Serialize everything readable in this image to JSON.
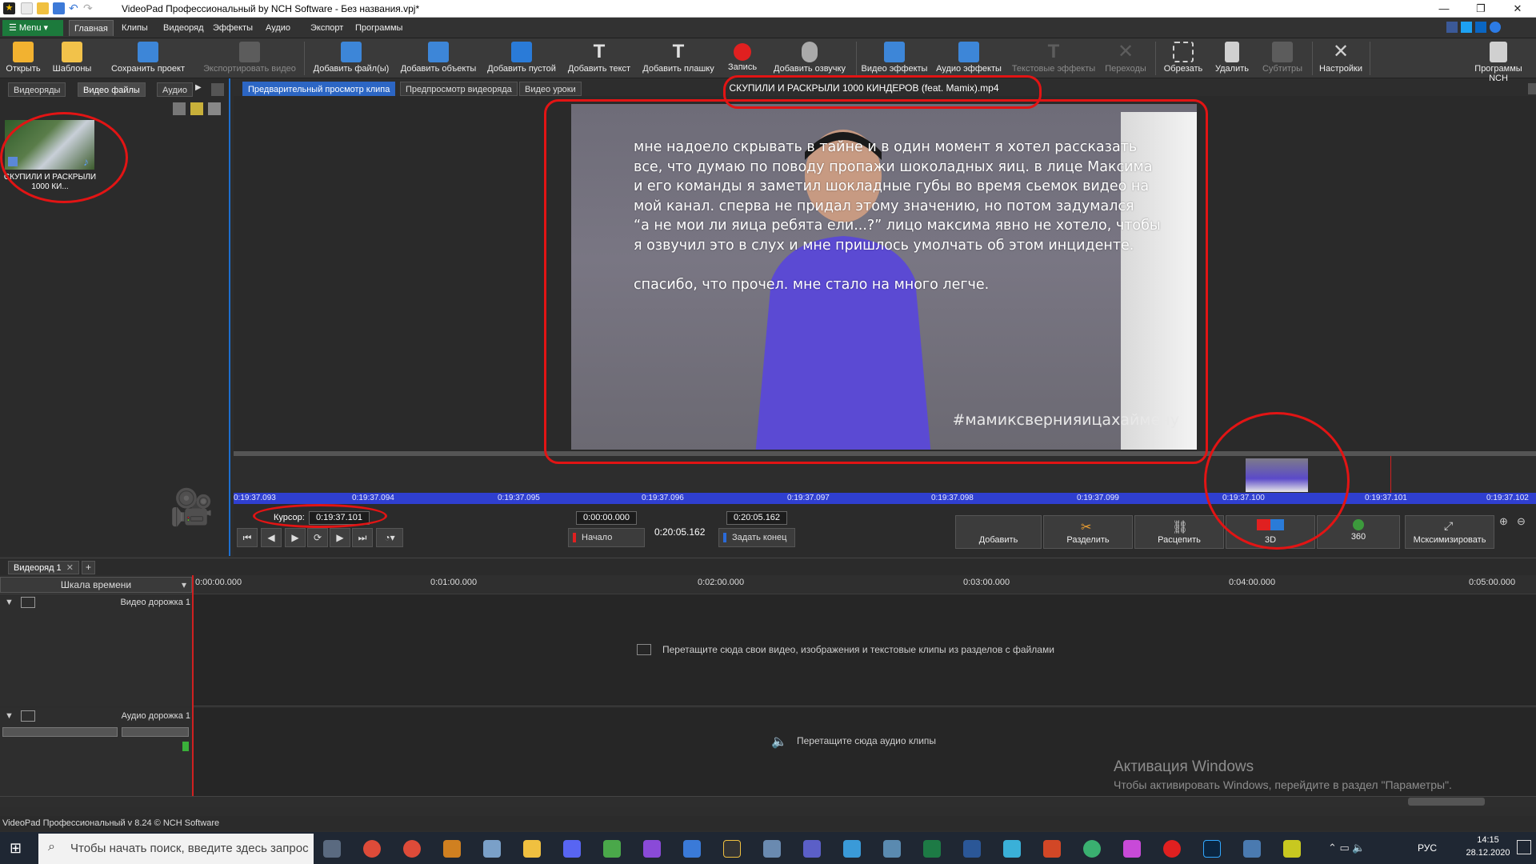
{
  "window": {
    "title": "VideoPad Профессиональный by NCH Software - Без названия.vpj*",
    "min": "—",
    "max": "❐",
    "close": "✕"
  },
  "menubar": {
    "menu_label": "☰ Menu ▾",
    "items": [
      "Главная",
      "Клипы",
      "Видеоряд",
      "Эффекты",
      "Аудио",
      "Экспорт",
      "Программы"
    ]
  },
  "ribbon": {
    "buttons": [
      {
        "label": "Открыть",
        "icon": "open-folder-icon",
        "color": "#f2b230"
      },
      {
        "label": "Шаблоны",
        "icon": "templates-icon",
        "color": "#f2c24a"
      },
      {
        "label": "Сохранить проект",
        "icon": "save-icon",
        "color": "#3d86d8"
      },
      {
        "label": "Экспортировать видео",
        "icon": "export-icon",
        "color": "#888888"
      },
      {
        "label": "Добавить файл(ы)",
        "icon": "add-file-icon",
        "color": "#3d86d8"
      },
      {
        "label": "Добавить объекты",
        "icon": "add-objects-icon",
        "color": "#3d86d8"
      },
      {
        "label": "Добавить пустой",
        "icon": "add-blank-icon",
        "color": "#2a7bd8"
      },
      {
        "label": "Добавить текст",
        "icon": "text-icon",
        "color": "#e0e0e0"
      },
      {
        "label": "Добавить плашку",
        "icon": "title-plate-icon",
        "color": "#e0e0e0"
      },
      {
        "label": "Запись",
        "icon": "record-icon",
        "color": "#e02020"
      },
      {
        "label": "Добавить озвучку",
        "icon": "microphone-icon",
        "color": "#aaaaaa"
      },
      {
        "label": "Видео эффекты",
        "icon": "video-fx-icon",
        "color": "#3d86d8"
      },
      {
        "label": "Аудио эффекты",
        "icon": "audio-fx-icon",
        "color": "#3d86d8"
      },
      {
        "label": "Текстовые эффекты",
        "icon": "text-fx-icon",
        "color": "#888888"
      },
      {
        "label": "Переходы",
        "icon": "transitions-icon",
        "color": "#888888"
      },
      {
        "label": "Обрезать",
        "icon": "crop-icon",
        "color": "#d0d0d0"
      },
      {
        "label": "Удалить",
        "icon": "delete-icon",
        "color": "#d0d0d0"
      },
      {
        "label": "Субтитры",
        "icon": "subtitles-icon",
        "color": "#888888"
      },
      {
        "label": "Настройки",
        "icon": "settings-icon",
        "color": "#d0d0d0"
      },
      {
        "label": "Программы NCH",
        "icon": "nch-programs-icon",
        "color": "#d0d0d0"
      }
    ]
  },
  "left_panel": {
    "tabs": [
      "Видеоряды",
      "Видео файлы",
      "Аудио"
    ],
    "clip_caption": "СКУПИЛИ И РАСКРЫЛИ 1000 КИ..."
  },
  "preview": {
    "tabs": [
      "Предварительный просмотр клипа",
      "Предпросмотр видеоряда",
      "Видео уроки"
    ],
    "clip_title": "СКУПИЛИ И РАСКРЫЛИ 1000 КИНДЕРОВ (feat. Mamix).mp4",
    "video_text": "мне надоело скрывать в тайне и в один момент я хотел рассказать\nвсе, что думаю по поводу пропажи шоколадных яиц. в лице Максима\nи его команды я заметил шокладные губы во время сьемок видео на\nмой канал. сперва не придал этому значению, но потом задумался\n“а не мои ли яица ребята ели...?” лицо максима явно не хотело, чтобы\nя озвучил это в слух и мне пришлось умолчать об этом инциденте.\n\nспасибо, что прочел. мне стало на много легче.",
    "hashtag": "#мамиксвернияицахаймену",
    "ruler_ticks": [
      "0:19:37.093",
      "0:19:37.094",
      "0:19:37.095",
      "0:19:37.096",
      "0:19:37.097",
      "0:19:37.098",
      "0:19:37.099",
      "0:19:37.100",
      "0:19:37.101",
      "0:19:37.102"
    ]
  },
  "transport": {
    "cursor_label": "Курсор:",
    "cursor_value": "0:19:37.101",
    "start_time": "0:00:00.000",
    "duration": "0:20:05.162",
    "end_time": "0:20:05.162",
    "start_btn": "Начало",
    "end_btn": "Задать конец",
    "buttons": [
      "Добавить",
      "Разделить",
      "Расцепить",
      "3D",
      "360",
      "Мсксимизировать"
    ]
  },
  "timeline": {
    "sequence_tab": "Видеоряд 1",
    "scale_label": "Шкала времени",
    "ticks": [
      "0:00:00.000",
      "0:01:00.000",
      "0:02:00.000",
      "0:03:00.000",
      "0:04:00.000",
      "0:05:00.000"
    ],
    "video_track": "Видео дорожка 1",
    "audio_track": "Аудио дорожка 1",
    "video_hint": "Перетащите сюда свои видео, изображения и текстовые клипы из разделов с файлами",
    "audio_hint": "Перетащите сюда аудио клипы"
  },
  "status": {
    "text": "VideoPad Профессиональный v 8.24 © NCH Software",
    "watermark_title": "Активация Windows",
    "watermark_sub": "Чтобы активировать Windows, перейдите в раздел \"Параметры\"."
  },
  "taskbar": {
    "search_placeholder": "Чтобы начать поиск, введите здесь запрос",
    "lang": "РУС",
    "time": "14:15",
    "date": "28.12.2020"
  }
}
